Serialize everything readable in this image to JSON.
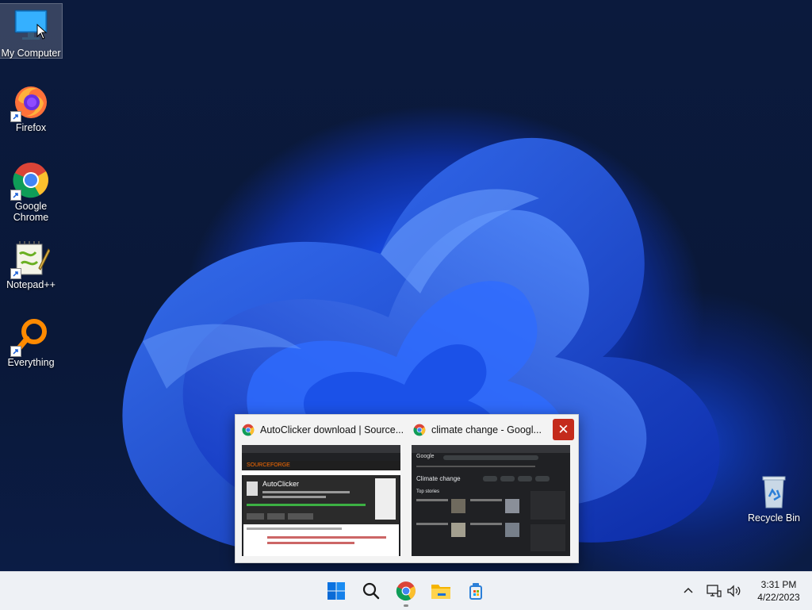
{
  "desktop": {
    "icons": [
      {
        "label": "My Computer",
        "icon": "monitor-icon",
        "selected": true
      },
      {
        "label": "Firefox",
        "icon": "firefox-icon"
      },
      {
        "label": "Google Chrome",
        "icon": "chrome-icon"
      },
      {
        "label": "Notepad++",
        "icon": "notepadpp-icon"
      },
      {
        "label": "Everything",
        "icon": "everything-search-icon"
      },
      {
        "label": "Recycle Bin",
        "icon": "recycle-bin-icon"
      }
    ]
  },
  "thumbnails": [
    {
      "title": "AutoClicker download | Source...",
      "icon": "chrome-icon",
      "preview": {
        "site": "SOURCEFORGE",
        "heading": "AutoClicker"
      }
    },
    {
      "title": "climate change - Googl...",
      "icon": "chrome-icon",
      "preview": {
        "site": "Google",
        "heading": "Climate change",
        "section": "Top stories"
      }
    }
  ],
  "thumbnail_close_icon": "close-icon",
  "taskbar": {
    "items": [
      "start-icon",
      "search-icon",
      "chrome-icon",
      "file-explorer-icon",
      "app-icon"
    ],
    "tray": [
      "chevron-up-icon",
      "network-icon",
      "volume-icon"
    ],
    "clock": {
      "time": "3:31 PM",
      "date": "4/22/2023"
    }
  },
  "colors": {
    "accent": "#1d5cf5",
    "close": "#c42b1c",
    "taskbar": "#eef1f5"
  }
}
